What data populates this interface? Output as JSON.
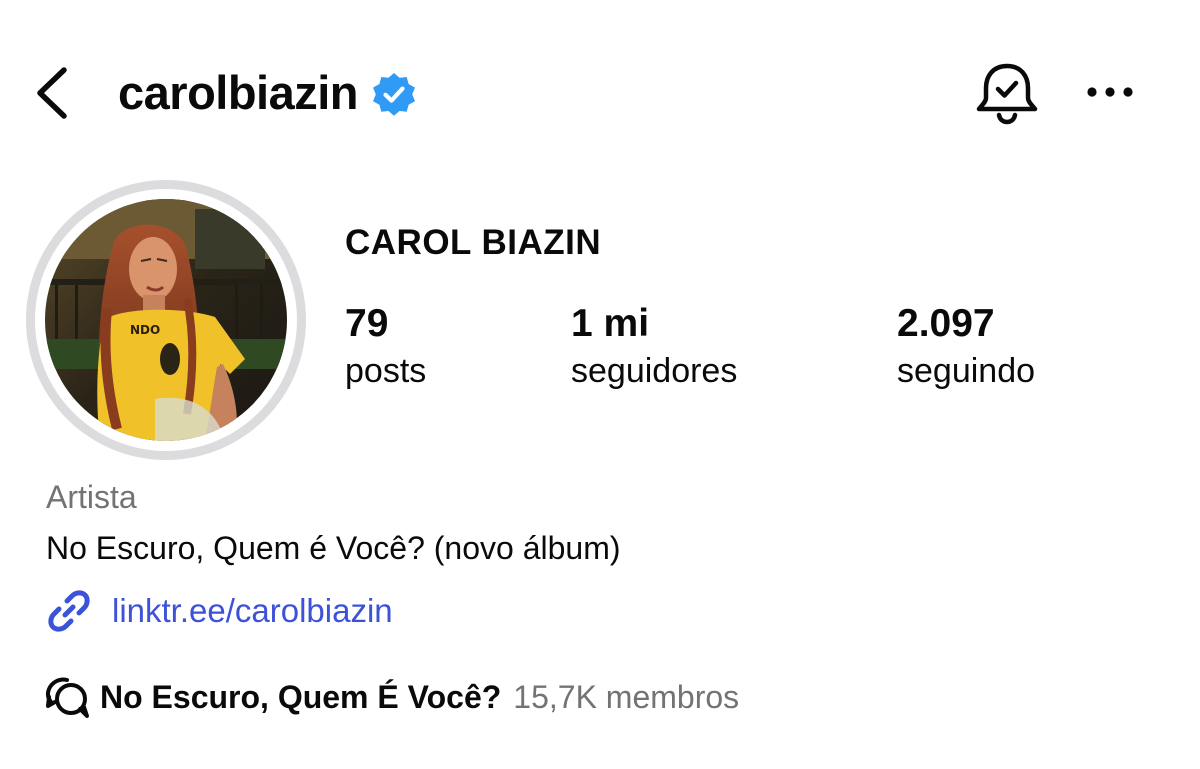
{
  "header": {
    "username": "carolbiazin",
    "verified": true,
    "back_icon": "chevron-left-icon",
    "bell_icon": "bell-check-icon",
    "more_icon": "more-horizontal-icon"
  },
  "profile": {
    "display_name": "CAROL BIAZIN",
    "avatar_description": "profile-photo"
  },
  "stats": {
    "posts": {
      "value": "79",
      "label": "posts"
    },
    "followers": {
      "value": "1 mi",
      "label": "seguidores"
    },
    "following": {
      "value": "2.097",
      "label": "seguindo"
    }
  },
  "bio": {
    "category": "Artista",
    "text": "No Escuro, Quem é Você? (novo álbum)",
    "link": "linktr.ee/carolbiazin",
    "link_icon": "link-icon"
  },
  "channel": {
    "icon": "chat-bubbles-icon",
    "name": "No Escuro, Quem É Você?",
    "members": "15,7K membros"
  },
  "colors": {
    "text": "#0a0a0a",
    "secondary_text": "#737373",
    "link": "#3c52d8",
    "verified_badge": "#2f9bf5",
    "avatar_ring": "#dcdcdf"
  }
}
